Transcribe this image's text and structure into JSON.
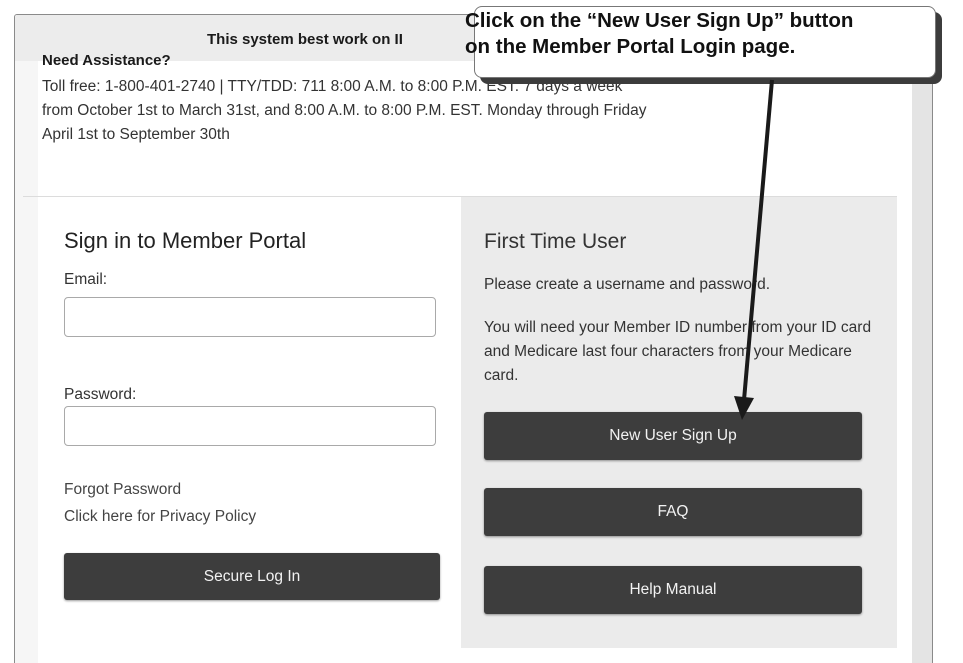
{
  "banner": {
    "text": "This system best work on II"
  },
  "assistance": {
    "title": "Need Assistance?",
    "line1": "Toll free: 1-800-401-2740 | TTY/TDD: 711 8:00 A.M. to 8:00 P.M. EST. 7 days a week",
    "line2": "from October 1st to March 31st, and 8:00 A.M. to 8:00 P.M. EST. Monday through Friday",
    "line3": "April 1st to September 30th"
  },
  "signin": {
    "title": "Sign in to Member Portal",
    "email_label": "Email:",
    "email_value": "",
    "password_label": "Password:",
    "password_value": "",
    "forgot_password": "Forgot Password",
    "privacy_policy": "Click here for Privacy Policy",
    "login_button": "Secure Log In"
  },
  "first_time": {
    "title": "First Time User",
    "text1": "Please create a username and password.",
    "text2": "You will need your Member ID number from your ID card and Medicare last four characters from your Medicare card.",
    "signup_button": "New User Sign Up",
    "faq_button": "FAQ",
    "help_button": "Help Manual"
  },
  "callout": {
    "line1": "Click on the “New User Sign Up” button",
    "line2": "on the Member Portal Login page."
  },
  "colors": {
    "button_bg": "#3d3d3d",
    "panel_bg": "#ebebeb",
    "callout_shadow": "#3c3c3c"
  }
}
